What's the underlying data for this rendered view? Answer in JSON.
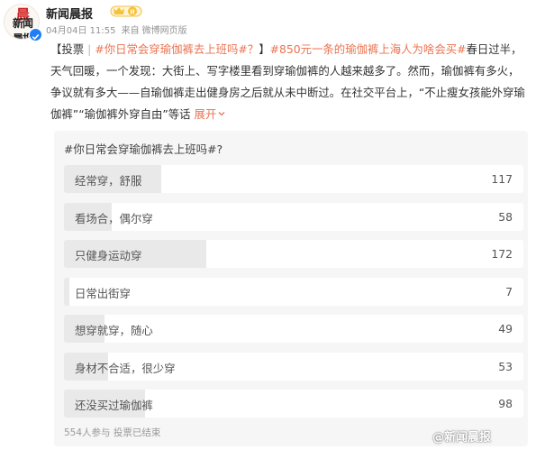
{
  "account": {
    "name": "新闻晨报",
    "vip_level": "II",
    "avatar_text": "新闻晨报",
    "avatar_accent": "晨"
  },
  "meta": {
    "time": "04月04日 11:55",
    "source_prefix": "来自",
    "source": "微博网页版"
  },
  "post": {
    "tag_open": "【投票",
    "divider": "|",
    "hashtag1": "#你日常会穿瑜伽裤去上班吗#？",
    "tag_close": "】",
    "hashtag2": "#850元一条的瑜伽裤上海人为啥会买#",
    "body": "春日过半，天气回暖，一个发现：大街上、写字楼里看到穿瑜伽裤的人越来越多了。然而，瑜伽裤有多火，争议就有多大——自瑜伽裤走出健身房之后就从未中断过。在社交平台上，“不止瘦女孩能外穿瑜伽裤”“瑜伽裤外穿自由”等话",
    "expand": "展开"
  },
  "poll": {
    "title": "#你日常会穿瑜伽裤去上班吗#?",
    "options": [
      {
        "label": "经常穿，舒服",
        "count": "117",
        "value": 117
      },
      {
        "label": "看场合，偶尔穿",
        "count": "58",
        "value": 58
      },
      {
        "label": "只健身运动穿",
        "count": "172",
        "value": 172
      },
      {
        "label": "日常出街穿",
        "count": "7",
        "value": 7
      },
      {
        "label": "想穿就穿，随心",
        "count": "49",
        "value": 49
      },
      {
        "label": "身材不合适，很少穿",
        "count": "53",
        "value": 53
      },
      {
        "label": "还没买过瑜伽裤",
        "count": "98",
        "value": 98
      }
    ],
    "footer": "554人参与 投票已结束"
  },
  "watermark": "@新闻晨报",
  "colors": {
    "accent": "#eb7350",
    "poll_bg": "#f6f6f6",
    "bar_fill": "#e9e9e9",
    "verified": "#1f7ef6",
    "vip": "#f7c23a"
  },
  "icons": [
    "verified-icon",
    "vip-badge-icon",
    "chevron-down-icon"
  ]
}
